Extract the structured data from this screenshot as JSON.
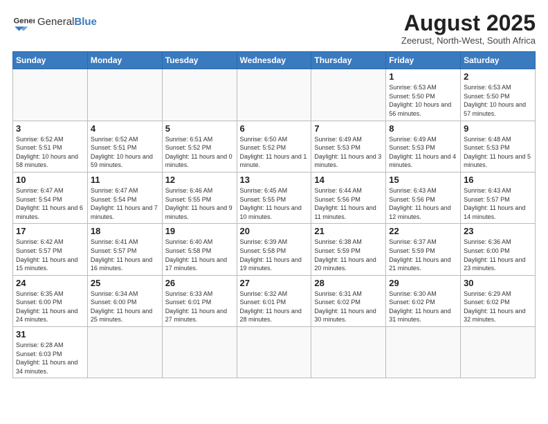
{
  "logo": {
    "text_regular": "General",
    "text_bold": "Blue"
  },
  "title": "August 2025",
  "subtitle": "Zeerust, North-West, South Africa",
  "headers": [
    "Sunday",
    "Monday",
    "Tuesday",
    "Wednesday",
    "Thursday",
    "Friday",
    "Saturday"
  ],
  "weeks": [
    [
      {
        "day": "",
        "info": ""
      },
      {
        "day": "",
        "info": ""
      },
      {
        "day": "",
        "info": ""
      },
      {
        "day": "",
        "info": ""
      },
      {
        "day": "",
        "info": ""
      },
      {
        "day": "1",
        "info": "Sunrise: 6:53 AM\nSunset: 5:50 PM\nDaylight: 10 hours and 56 minutes."
      },
      {
        "day": "2",
        "info": "Sunrise: 6:53 AM\nSunset: 5:50 PM\nDaylight: 10 hours and 57 minutes."
      }
    ],
    [
      {
        "day": "3",
        "info": "Sunrise: 6:52 AM\nSunset: 5:51 PM\nDaylight: 10 hours and 58 minutes."
      },
      {
        "day": "4",
        "info": "Sunrise: 6:52 AM\nSunset: 5:51 PM\nDaylight: 10 hours and 59 minutes."
      },
      {
        "day": "5",
        "info": "Sunrise: 6:51 AM\nSunset: 5:52 PM\nDaylight: 11 hours and 0 minutes."
      },
      {
        "day": "6",
        "info": "Sunrise: 6:50 AM\nSunset: 5:52 PM\nDaylight: 11 hours and 1 minute."
      },
      {
        "day": "7",
        "info": "Sunrise: 6:49 AM\nSunset: 5:53 PM\nDaylight: 11 hours and 3 minutes."
      },
      {
        "day": "8",
        "info": "Sunrise: 6:49 AM\nSunset: 5:53 PM\nDaylight: 11 hours and 4 minutes."
      },
      {
        "day": "9",
        "info": "Sunrise: 6:48 AM\nSunset: 5:53 PM\nDaylight: 11 hours and 5 minutes."
      }
    ],
    [
      {
        "day": "10",
        "info": "Sunrise: 6:47 AM\nSunset: 5:54 PM\nDaylight: 11 hours and 6 minutes."
      },
      {
        "day": "11",
        "info": "Sunrise: 6:47 AM\nSunset: 5:54 PM\nDaylight: 11 hours and 7 minutes."
      },
      {
        "day": "12",
        "info": "Sunrise: 6:46 AM\nSunset: 5:55 PM\nDaylight: 11 hours and 9 minutes."
      },
      {
        "day": "13",
        "info": "Sunrise: 6:45 AM\nSunset: 5:55 PM\nDaylight: 11 hours and 10 minutes."
      },
      {
        "day": "14",
        "info": "Sunrise: 6:44 AM\nSunset: 5:56 PM\nDaylight: 11 hours and 11 minutes."
      },
      {
        "day": "15",
        "info": "Sunrise: 6:43 AM\nSunset: 5:56 PM\nDaylight: 11 hours and 12 minutes."
      },
      {
        "day": "16",
        "info": "Sunrise: 6:43 AM\nSunset: 5:57 PM\nDaylight: 11 hours and 14 minutes."
      }
    ],
    [
      {
        "day": "17",
        "info": "Sunrise: 6:42 AM\nSunset: 5:57 PM\nDaylight: 11 hours and 15 minutes."
      },
      {
        "day": "18",
        "info": "Sunrise: 6:41 AM\nSunset: 5:57 PM\nDaylight: 11 hours and 16 minutes."
      },
      {
        "day": "19",
        "info": "Sunrise: 6:40 AM\nSunset: 5:58 PM\nDaylight: 11 hours and 17 minutes."
      },
      {
        "day": "20",
        "info": "Sunrise: 6:39 AM\nSunset: 5:58 PM\nDaylight: 11 hours and 19 minutes."
      },
      {
        "day": "21",
        "info": "Sunrise: 6:38 AM\nSunset: 5:59 PM\nDaylight: 11 hours and 20 minutes."
      },
      {
        "day": "22",
        "info": "Sunrise: 6:37 AM\nSunset: 5:59 PM\nDaylight: 11 hours and 21 minutes."
      },
      {
        "day": "23",
        "info": "Sunrise: 6:36 AM\nSunset: 6:00 PM\nDaylight: 11 hours and 23 minutes."
      }
    ],
    [
      {
        "day": "24",
        "info": "Sunrise: 6:35 AM\nSunset: 6:00 PM\nDaylight: 11 hours and 24 minutes."
      },
      {
        "day": "25",
        "info": "Sunrise: 6:34 AM\nSunset: 6:00 PM\nDaylight: 11 hours and 25 minutes."
      },
      {
        "day": "26",
        "info": "Sunrise: 6:33 AM\nSunset: 6:01 PM\nDaylight: 11 hours and 27 minutes."
      },
      {
        "day": "27",
        "info": "Sunrise: 6:32 AM\nSunset: 6:01 PM\nDaylight: 11 hours and 28 minutes."
      },
      {
        "day": "28",
        "info": "Sunrise: 6:31 AM\nSunset: 6:02 PM\nDaylight: 11 hours and 30 minutes."
      },
      {
        "day": "29",
        "info": "Sunrise: 6:30 AM\nSunset: 6:02 PM\nDaylight: 11 hours and 31 minutes."
      },
      {
        "day": "30",
        "info": "Sunrise: 6:29 AM\nSunset: 6:02 PM\nDaylight: 11 hours and 32 minutes."
      }
    ],
    [
      {
        "day": "31",
        "info": "Sunrise: 6:28 AM\nSunset: 6:03 PM\nDaylight: 11 hours and 34 minutes."
      },
      {
        "day": "",
        "info": ""
      },
      {
        "day": "",
        "info": ""
      },
      {
        "day": "",
        "info": ""
      },
      {
        "day": "",
        "info": ""
      },
      {
        "day": "",
        "info": ""
      },
      {
        "day": "",
        "info": ""
      }
    ]
  ]
}
